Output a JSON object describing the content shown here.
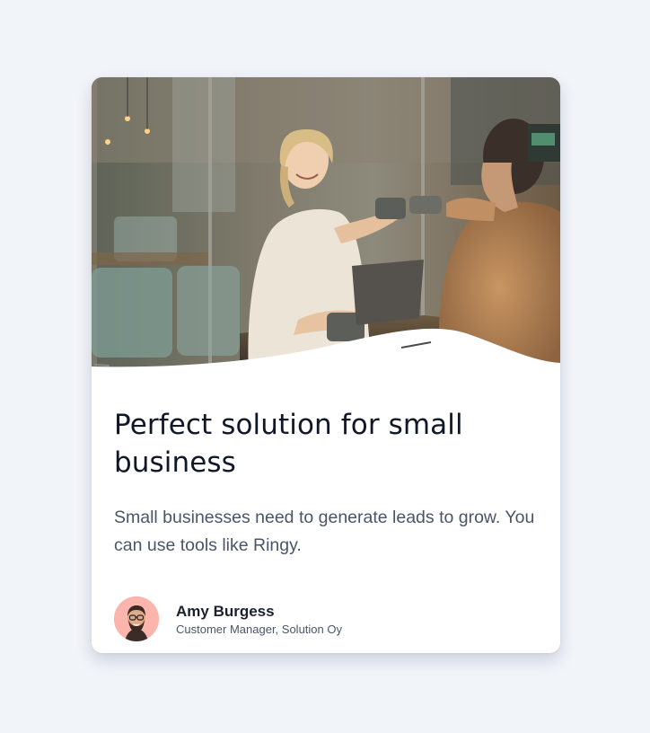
{
  "card": {
    "title": "Perfect solution for small business",
    "description": "Small businesses need to generate leads to grow. You can use tools like Ringy.",
    "image_icon": "cafe-photo",
    "author": {
      "name": "Amy Burgess",
      "role": "Customer Manager, Solution Oy",
      "avatar_icon": "memoji-avatar",
      "avatar_bg": "#fbb5ad"
    }
  },
  "colors": {
    "page_bg": "#f1f4f9",
    "card_bg": "#ffffff",
    "title": "#101828",
    "body": "#4a5568"
  }
}
